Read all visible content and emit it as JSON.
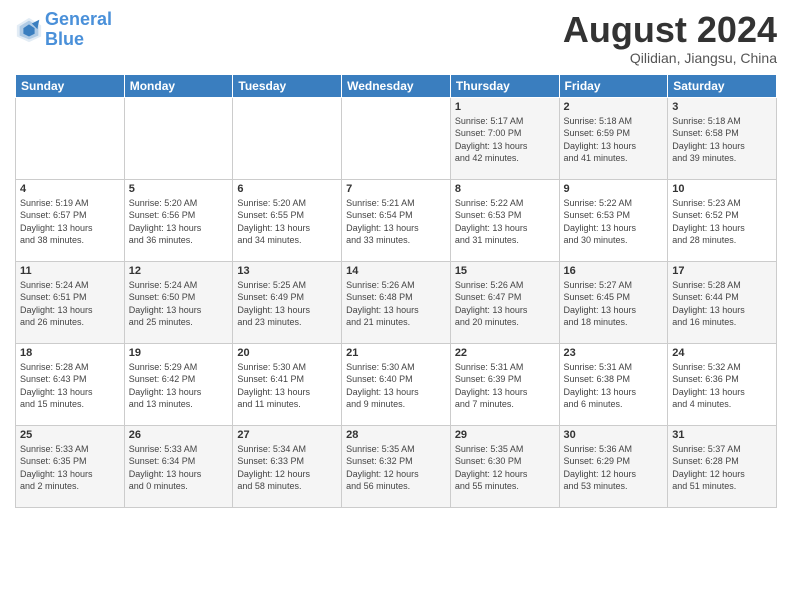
{
  "header": {
    "logo_line1": "General",
    "logo_line2": "Blue",
    "month_title": "August 2024",
    "location": "Qilidian, Jiangsu, China"
  },
  "weekdays": [
    "Sunday",
    "Monday",
    "Tuesday",
    "Wednesday",
    "Thursday",
    "Friday",
    "Saturday"
  ],
  "weeks": [
    [
      {
        "day": "",
        "info": ""
      },
      {
        "day": "",
        "info": ""
      },
      {
        "day": "",
        "info": ""
      },
      {
        "day": "",
        "info": ""
      },
      {
        "day": "1",
        "info": "Sunrise: 5:17 AM\nSunset: 7:00 PM\nDaylight: 13 hours\nand 42 minutes."
      },
      {
        "day": "2",
        "info": "Sunrise: 5:18 AM\nSunset: 6:59 PM\nDaylight: 13 hours\nand 41 minutes."
      },
      {
        "day": "3",
        "info": "Sunrise: 5:18 AM\nSunset: 6:58 PM\nDaylight: 13 hours\nand 39 minutes."
      }
    ],
    [
      {
        "day": "4",
        "info": "Sunrise: 5:19 AM\nSunset: 6:57 PM\nDaylight: 13 hours\nand 38 minutes."
      },
      {
        "day": "5",
        "info": "Sunrise: 5:20 AM\nSunset: 6:56 PM\nDaylight: 13 hours\nand 36 minutes."
      },
      {
        "day": "6",
        "info": "Sunrise: 5:20 AM\nSunset: 6:55 PM\nDaylight: 13 hours\nand 34 minutes."
      },
      {
        "day": "7",
        "info": "Sunrise: 5:21 AM\nSunset: 6:54 PM\nDaylight: 13 hours\nand 33 minutes."
      },
      {
        "day": "8",
        "info": "Sunrise: 5:22 AM\nSunset: 6:53 PM\nDaylight: 13 hours\nand 31 minutes."
      },
      {
        "day": "9",
        "info": "Sunrise: 5:22 AM\nSunset: 6:53 PM\nDaylight: 13 hours\nand 30 minutes."
      },
      {
        "day": "10",
        "info": "Sunrise: 5:23 AM\nSunset: 6:52 PM\nDaylight: 13 hours\nand 28 minutes."
      }
    ],
    [
      {
        "day": "11",
        "info": "Sunrise: 5:24 AM\nSunset: 6:51 PM\nDaylight: 13 hours\nand 26 minutes."
      },
      {
        "day": "12",
        "info": "Sunrise: 5:24 AM\nSunset: 6:50 PM\nDaylight: 13 hours\nand 25 minutes."
      },
      {
        "day": "13",
        "info": "Sunrise: 5:25 AM\nSunset: 6:49 PM\nDaylight: 13 hours\nand 23 minutes."
      },
      {
        "day": "14",
        "info": "Sunrise: 5:26 AM\nSunset: 6:48 PM\nDaylight: 13 hours\nand 21 minutes."
      },
      {
        "day": "15",
        "info": "Sunrise: 5:26 AM\nSunset: 6:47 PM\nDaylight: 13 hours\nand 20 minutes."
      },
      {
        "day": "16",
        "info": "Sunrise: 5:27 AM\nSunset: 6:45 PM\nDaylight: 13 hours\nand 18 minutes."
      },
      {
        "day": "17",
        "info": "Sunrise: 5:28 AM\nSunset: 6:44 PM\nDaylight: 13 hours\nand 16 minutes."
      }
    ],
    [
      {
        "day": "18",
        "info": "Sunrise: 5:28 AM\nSunset: 6:43 PM\nDaylight: 13 hours\nand 15 minutes."
      },
      {
        "day": "19",
        "info": "Sunrise: 5:29 AM\nSunset: 6:42 PM\nDaylight: 13 hours\nand 13 minutes."
      },
      {
        "day": "20",
        "info": "Sunrise: 5:30 AM\nSunset: 6:41 PM\nDaylight: 13 hours\nand 11 minutes."
      },
      {
        "day": "21",
        "info": "Sunrise: 5:30 AM\nSunset: 6:40 PM\nDaylight: 13 hours\nand 9 minutes."
      },
      {
        "day": "22",
        "info": "Sunrise: 5:31 AM\nSunset: 6:39 PM\nDaylight: 13 hours\nand 7 minutes."
      },
      {
        "day": "23",
        "info": "Sunrise: 5:31 AM\nSunset: 6:38 PM\nDaylight: 13 hours\nand 6 minutes."
      },
      {
        "day": "24",
        "info": "Sunrise: 5:32 AM\nSunset: 6:36 PM\nDaylight: 13 hours\nand 4 minutes."
      }
    ],
    [
      {
        "day": "25",
        "info": "Sunrise: 5:33 AM\nSunset: 6:35 PM\nDaylight: 13 hours\nand 2 minutes."
      },
      {
        "day": "26",
        "info": "Sunrise: 5:33 AM\nSunset: 6:34 PM\nDaylight: 13 hours\nand 0 minutes."
      },
      {
        "day": "27",
        "info": "Sunrise: 5:34 AM\nSunset: 6:33 PM\nDaylight: 12 hours\nand 58 minutes."
      },
      {
        "day": "28",
        "info": "Sunrise: 5:35 AM\nSunset: 6:32 PM\nDaylight: 12 hours\nand 56 minutes."
      },
      {
        "day": "29",
        "info": "Sunrise: 5:35 AM\nSunset: 6:30 PM\nDaylight: 12 hours\nand 55 minutes."
      },
      {
        "day": "30",
        "info": "Sunrise: 5:36 AM\nSunset: 6:29 PM\nDaylight: 12 hours\nand 53 minutes."
      },
      {
        "day": "31",
        "info": "Sunrise: 5:37 AM\nSunset: 6:28 PM\nDaylight: 12 hours\nand 51 minutes."
      }
    ]
  ]
}
